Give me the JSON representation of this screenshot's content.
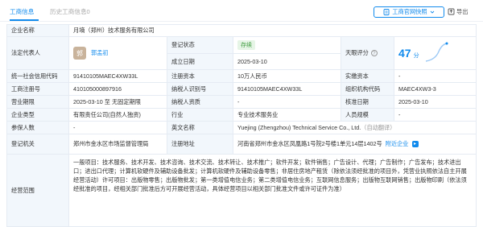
{
  "tabs": {
    "active": "工商信息",
    "inactive": "历史工商信息0"
  },
  "toolbar": {
    "report_label": "工商官网快照",
    "export_label": "导出"
  },
  "rows": {
    "company_name_label": "企业名称",
    "company_name": "月墒（郑州）技术服务有限公司",
    "legal_rep_label": "法定代表人",
    "legal_rep_avatar": "郭",
    "legal_rep_name": "郭孟初",
    "reg_status_label": "登记状态",
    "reg_status": "存续",
    "est_date_label": "成立日期",
    "est_date": "2025-03-10",
    "risk_label": "天眼评分",
    "score": "47",
    "score_unit": "分",
    "usc_label": "统一社会信用代码",
    "usc": "91410105MAEC4XW33L",
    "capital_label": "注册资本",
    "capital": "10万人民币",
    "paid_label": "实缴资本",
    "paid": "-",
    "reg_no_label": "工商注册号",
    "reg_no": "410105000897916",
    "tax_label": "纳税人识别号",
    "tax": "91410105MAEC4XW33L",
    "org_label": "组织机构代码",
    "org": "MAEC4XW3-3",
    "term_label": "营业期限",
    "term": "2025-03-10 至 无固定期限",
    "taxpayer_label": "纳税人资质",
    "taxpayer": "-",
    "approve_label": "核准日期",
    "approve": "2025-03-10",
    "type_label": "企业类型",
    "type": "有限责任公司(自然人独资)",
    "industry_label": "行业",
    "industry": "专业技术服务业",
    "staff_label": "人员规模",
    "staff": "-",
    "insured_label": "参保人数",
    "insured": "-",
    "english_label": "英文名称",
    "english": "Yuejing (Zhengzhou) Technical Service Co., Ltd.",
    "english_note": "（自动翻译）",
    "authority_label": "登记机关",
    "authority": "郑州市金水区市场监督管理局",
    "address_label": "注册地址",
    "address": "河南省郑州市金水区凤凰路1号院2号楼1单元14层1402号",
    "address_link": "附近企业",
    "scope_label": "经营范围",
    "scope": "一般项目：技术服务、技术开发、技术咨询、技术交流、技术转让、技术推广；软件开发；软件销售；广告设计、代理；广告制作；广告发布；技术进出口；进出口代理；计算机软硬件及辅助设备批发；计算机软硬件及辅助设备零售；非居住房地产租赁（除依法须经批准的项目外，凭营业执照依法自主开展经营活动）许可项目：出版物零售；出版物批发；第一类增值电信业务；第二类增值电信业务；互联网信息服务；出版物互联网销售；出版物印刷（依法须经批准的项目，经相关部门批准后方可开展经营活动，具体经营项目以相关部门批准文件或许可证件为准）"
  }
}
